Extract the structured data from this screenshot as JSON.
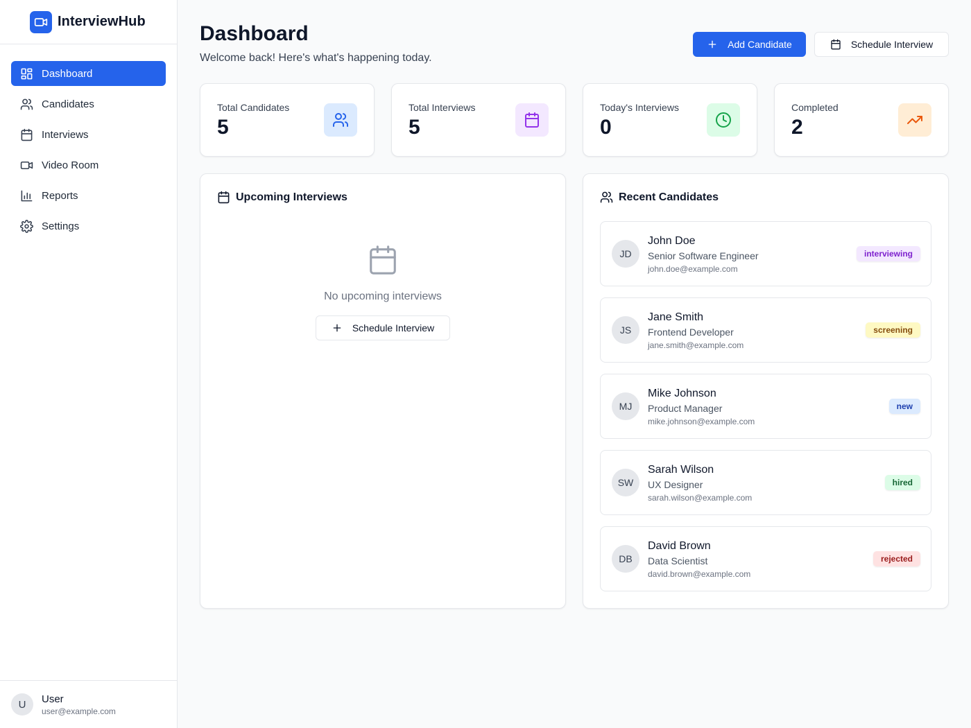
{
  "app": {
    "name": "InterviewHub"
  },
  "sidebar": {
    "items": [
      {
        "label": "Dashboard",
        "icon": "dashboard-icon",
        "active": true
      },
      {
        "label": "Candidates",
        "icon": "users-icon"
      },
      {
        "label": "Interviews",
        "icon": "calendar-icon"
      },
      {
        "label": "Video Room",
        "icon": "video-icon"
      },
      {
        "label": "Reports",
        "icon": "bar-chart-icon"
      },
      {
        "label": "Settings",
        "icon": "gear-icon"
      }
    ],
    "user": {
      "initial": "U",
      "name": "User",
      "email": "user@example.com"
    }
  },
  "header": {
    "title": "Dashboard",
    "subtitle": "Welcome back! Here's what's happening today.",
    "add_label": "Add Candidate",
    "schedule_label": "Schedule Interview"
  },
  "stats": [
    {
      "label": "Total Candidates",
      "value": "5",
      "icon": "users-icon",
      "bg": "#dbeafe",
      "fg": "#2563eb"
    },
    {
      "label": "Total Interviews",
      "value": "5",
      "icon": "calendar-icon",
      "bg": "#f3e8ff",
      "fg": "#9333ea"
    },
    {
      "label": "Today's Interviews",
      "value": "0",
      "icon": "clock-icon",
      "bg": "#dcfce7",
      "fg": "#16a34a"
    },
    {
      "label": "Completed",
      "value": "2",
      "icon": "trending-up-icon",
      "bg": "#ffedd5",
      "fg": "#ea580c"
    }
  ],
  "upcoming": {
    "title": "Upcoming Interviews",
    "empty_text": "No upcoming interviews",
    "button_label": "Schedule Interview"
  },
  "recent": {
    "title": "Recent Candidates",
    "candidates": [
      {
        "initials": "JD",
        "name": "John Doe",
        "role": "Senior Software Engineer",
        "email": "john.doe@example.com",
        "status": "interviewing",
        "badge_bg": "#f3e8ff",
        "badge_fg": "#7e22ce"
      },
      {
        "initials": "JS",
        "name": "Jane Smith",
        "role": "Frontend Developer",
        "email": "jane.smith@example.com",
        "status": "screening",
        "badge_bg": "#fef9c3",
        "badge_fg": "#854d0e"
      },
      {
        "initials": "MJ",
        "name": "Mike Johnson",
        "role": "Product Manager",
        "email": "mike.johnson@example.com",
        "status": "new",
        "badge_bg": "#dbeafe",
        "badge_fg": "#1e40af"
      },
      {
        "initials": "SW",
        "name": "Sarah Wilson",
        "role": "UX Designer",
        "email": "sarah.wilson@example.com",
        "status": "hired",
        "badge_bg": "#dcfce7",
        "badge_fg": "#166534"
      },
      {
        "initials": "DB",
        "name": "David Brown",
        "role": "Data Scientist",
        "email": "david.brown@example.com",
        "status": "rejected",
        "badge_bg": "#fee2e2",
        "badge_fg": "#991b1b"
      }
    ]
  }
}
